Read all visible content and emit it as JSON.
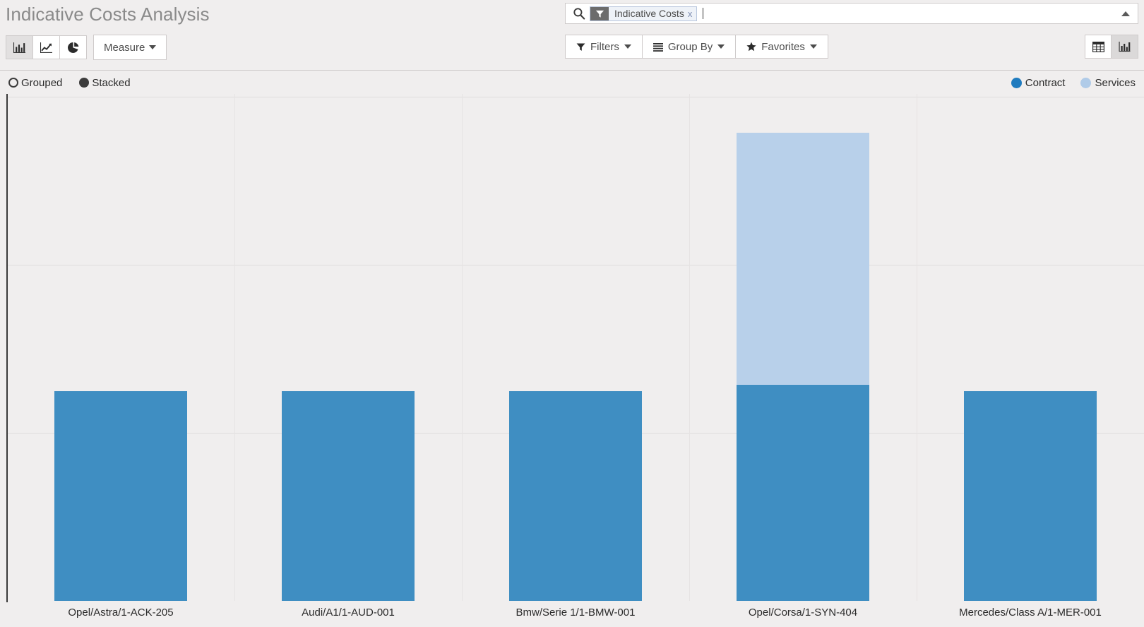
{
  "header": {
    "title": "Indicative Costs Analysis",
    "view_types": [
      {
        "name": "bar-chart",
        "label": "Bar Chart",
        "icon": "bar-chart-icon",
        "active": true
      },
      {
        "name": "line-chart",
        "label": "Line Chart",
        "icon": "line-chart-icon",
        "active": false
      },
      {
        "name": "pie-chart",
        "label": "Pie Chart",
        "icon": "pie-chart-icon",
        "active": false
      }
    ],
    "measure_label": "Measure"
  },
  "search": {
    "icon": "search-icon",
    "facets": [
      {
        "icon": "filter-icon",
        "label": "Indicative Costs",
        "close": "x"
      }
    ],
    "input_value": "",
    "placeholder": "",
    "toggle_icon": "caret-up-icon"
  },
  "toolbar": {
    "filters_label": "Filters",
    "group_by_label": "Group By",
    "favorites_label": "Favorites"
  },
  "view_switcher": [
    {
      "name": "pivot-view",
      "label": "Pivot",
      "icon": "table-icon",
      "active": false
    },
    {
      "name": "graph-view",
      "label": "Graph",
      "icon": "bar-chart-icon",
      "active": true
    }
  ],
  "chart_options": {
    "modes": [
      {
        "label": "Grouped",
        "selected": false
      },
      {
        "label": "Stacked",
        "selected": true
      }
    ]
  },
  "chart_data": {
    "type": "bar",
    "stacked": true,
    "title": "Indicative Costs Analysis",
    "xlabel": "",
    "ylabel": "",
    "grid": true,
    "legend_position": "top-right",
    "categories": [
      "Opel/Astra/1-ACK-205",
      "Audi/A1/1-AUD-001",
      "Bmw/Serie 1/1-BMW-001",
      "Opel/Corsa/1-SYN-404",
      "Mercedes/Class A/1-MER-001"
    ],
    "series": [
      {
        "name": "Contract",
        "color": "#3f8ec2",
        "values": [
          500,
          500,
          500,
          515,
          500
        ]
      },
      {
        "name": "Services",
        "color": "#b8d0ea",
        "values": [
          0,
          0,
          0,
          600,
          0
        ]
      }
    ],
    "ylim": [
      0,
      1200
    ],
    "yticks": [
      0,
      400,
      800,
      1200
    ]
  }
}
